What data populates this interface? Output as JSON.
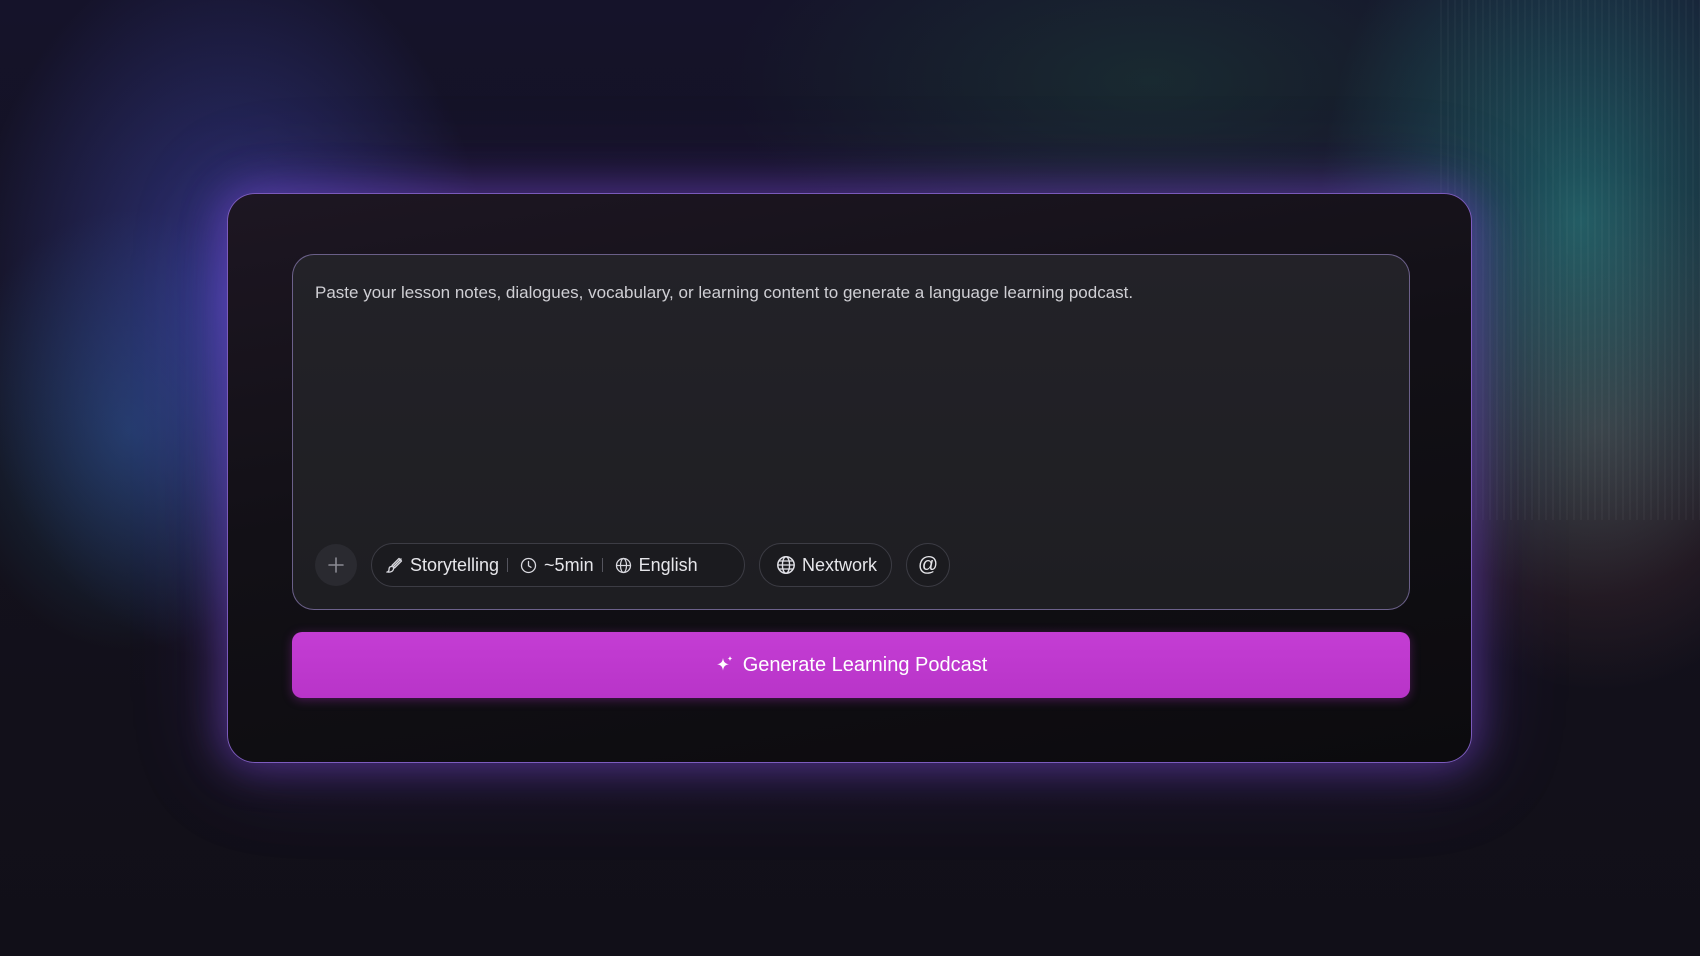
{
  "composer": {
    "placeholder": "Paste your lesson notes, dialogues, vocabulary, or learning content to generate a language learning podcast.",
    "value": ""
  },
  "toolbar": {
    "add_icon": "plus-icon",
    "style": {
      "icon": "brush-icon",
      "label": "Storytelling"
    },
    "duration": {
      "icon": "clock-icon",
      "label": "~5min"
    },
    "language": {
      "icon": "globe-icon",
      "label": "English"
    },
    "source": {
      "icon": "globe-icon",
      "label": "Nextwork"
    },
    "mention_icon": "at-icon",
    "mention_label": "@"
  },
  "generate_button": {
    "icon": "sparkle-icon",
    "label": "Generate Learning Podcast",
    "color": "#c43dd4"
  },
  "colors": {
    "accent": "#c43dd4",
    "card_glow": "#8250e6"
  }
}
